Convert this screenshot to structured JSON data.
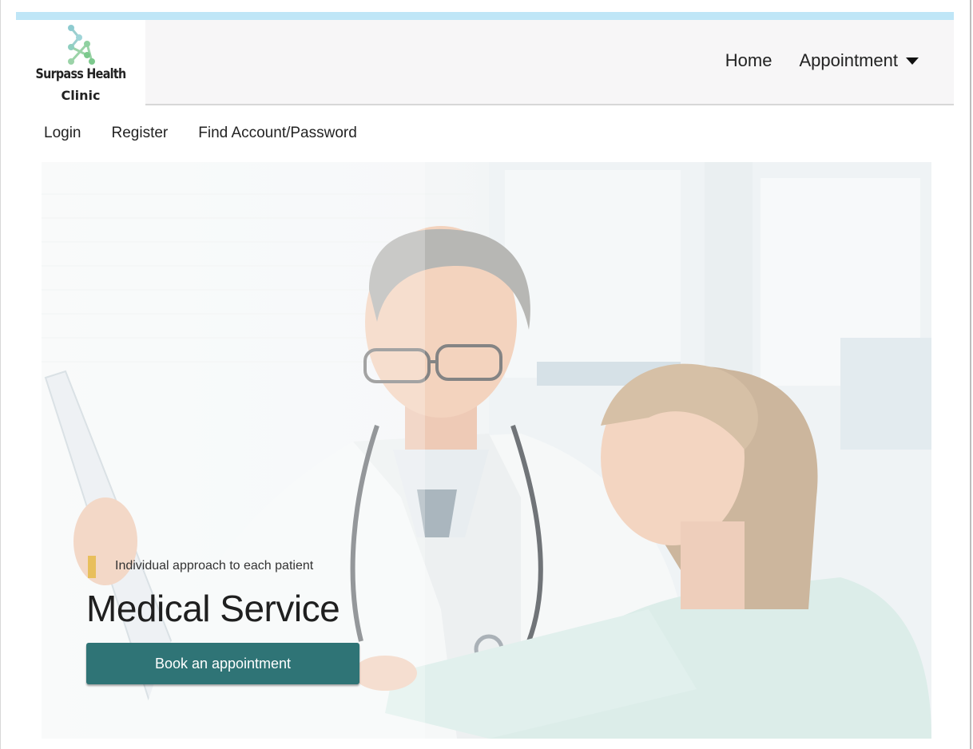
{
  "logo": {
    "line1": "Surpass Health",
    "line2": "Clinic"
  },
  "nav": {
    "home": "Home",
    "appointment": "Appointment"
  },
  "subnav": {
    "login": "Login",
    "register": "Register",
    "find": "Find Account/Password"
  },
  "hero": {
    "tagline": "Individual approach to each patient",
    "title": "Medical Service",
    "button": "Book an appointment"
  },
  "colors": {
    "accent": "#2f7476",
    "topbar": "#bfe6f7",
    "tagline_bar": "#e8bf5c"
  }
}
